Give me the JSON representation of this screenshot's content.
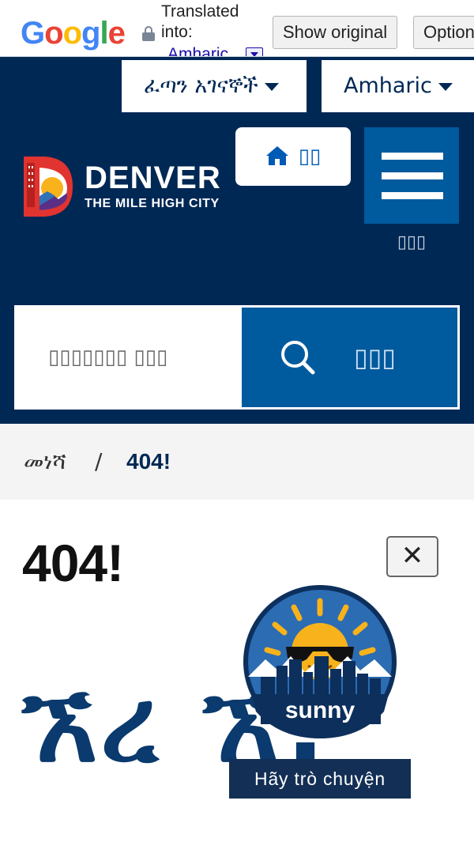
{
  "translate_bar": {
    "logo": [
      "G",
      "o",
      "o",
      "g",
      "l",
      "e"
    ],
    "logo_colors": [
      "#4285f4",
      "#ea4335",
      "#fbbc05",
      "#4285f4",
      "#34a853",
      "#ea4335"
    ],
    "translated_label": "Translated",
    "into_label": "into:",
    "language": "Amharic",
    "show_original_label": "Show original",
    "options_label": "Options"
  },
  "header": {
    "quick_links_label": "ፈጣን አገናኞች",
    "language_select_label": "Amharic",
    "logo_title": "DENVER",
    "logo_subtitle": "THE MILE HIGH CITY",
    "home_label": "▯▯",
    "menu_label": "▯▯▯"
  },
  "search": {
    "placeholder": "▯▯▯▯▯▯▯ ▯▯▯",
    "button_label": "▯▯▯"
  },
  "breadcrumb": {
    "home": "መነሻ",
    "separator": "/",
    "current": "404!"
  },
  "main": {
    "title": "404!",
    "close_label": "✕",
    "big_heading": "ኧረ ኧ!"
  },
  "chat": {
    "name": "sunny",
    "label": "Hãy trò chuyện"
  },
  "colors": {
    "navy": "#002855",
    "blue": "#005a9e",
    "sun": "#f8b21b"
  }
}
